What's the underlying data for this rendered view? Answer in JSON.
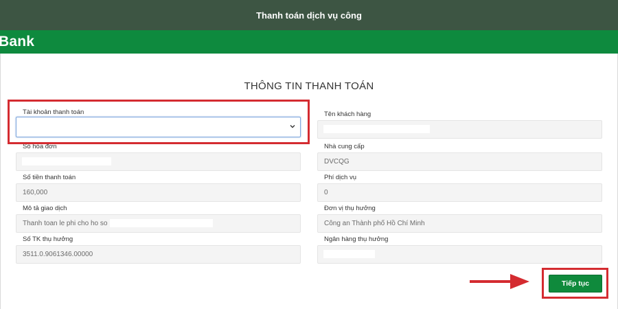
{
  "header": {
    "title": "Thanh toán dịch vụ công"
  },
  "brand": {
    "logo_text": "Bank"
  },
  "form": {
    "title": "THÔNG TIN THANH TOÁN",
    "left": [
      {
        "label": "Tài khoản thanh toán",
        "value": ""
      },
      {
        "label": "Số hóa đơn",
        "value": ""
      },
      {
        "label": "Số tiền thanh toán",
        "value": "160,000"
      },
      {
        "label": "Mô tả giao dịch",
        "value": "Thanh toan le phi cho ho so"
      },
      {
        "label": "Số TK thụ hưởng",
        "value": "3511.0.9061346.00000"
      }
    ],
    "right": [
      {
        "label": "Tên khách hàng",
        "value": ""
      },
      {
        "label": "Nhà cung cấp",
        "value": "DVCQG"
      },
      {
        "label": "Phí dịch vụ",
        "value": "0"
      },
      {
        "label": "Đơn vị thụ hưởng",
        "value": "Công an Thành phố Hồ Chí Minh"
      },
      {
        "label": "Ngân hàng thụ hưởng",
        "value": ""
      }
    ]
  },
  "actions": {
    "continue_label": "Tiếp tục"
  },
  "colors": {
    "header_bg": "#3d5543",
    "brand_bg": "#0e8a3e",
    "button_bg": "#0f8a3c",
    "highlight": "#d42b30",
    "focus_border": "#7fa7dd"
  },
  "icons": {
    "select_arrow": "chevron-down-icon",
    "annotation": "arrow-right-icon"
  }
}
